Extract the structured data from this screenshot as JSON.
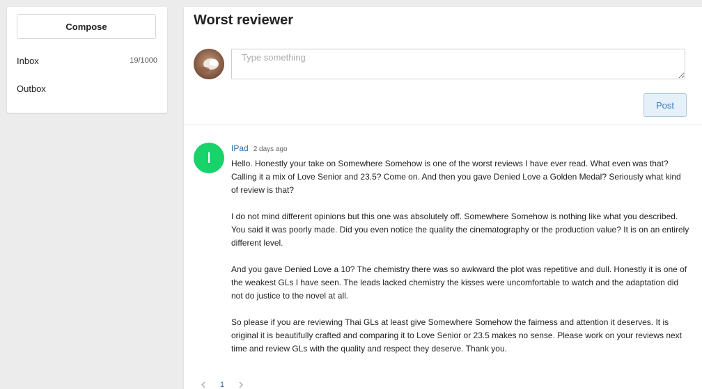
{
  "sidebar": {
    "compose_label": "Compose",
    "items": [
      {
        "label": "Inbox",
        "count": "19/1000"
      },
      {
        "label": "Outbox",
        "count": ""
      }
    ]
  },
  "thread": {
    "title": "Worst reviewer"
  },
  "composer": {
    "placeholder": "Type something",
    "post_label": "Post"
  },
  "comments": [
    {
      "avatar_letter": "I",
      "avatar_color": "#18d36a",
      "author": "IPad",
      "time": "2 days ago",
      "paragraphs": [
        "Hello. Honestly your take on Somewhere Somehow is one of the worst reviews I have ever read. What even was that? Calling it a mix of Love Senior and 23.5? Come on. And then you gave Denied Love a Golden Medal? Seriously what kind of review is that?",
        "I do not mind different opinions but this one was absolutely off. Somewhere Somehow is nothing like what you described. You said it was poorly made. Did you even notice the quality the cinematography or the production value? It is on an entirely different level.",
        "And you gave Denied Love a 10? The chemistry there was so awkward the plot was repetitive and dull. Honestly it is one of the weakest GLs I have seen. The leads lacked chemistry the kisses were uncomfortable to watch and the adaptation did not do justice to the novel at all.",
        "So please if you are reviewing Thai GLs at least give Somewhere Somehow the fairness and attention it deserves. It is original it is beautifully crafted and comparing it to Love Senior or 23.5 makes no sense. Please work on your reviews next time and review GLs with the quality and respect they deserve. Thank you."
      ]
    }
  ],
  "pagination": {
    "current_page": "1"
  },
  "colors": {
    "link": "#2a6cb0",
    "post_button_bg": "#e6f0f9",
    "background": "#ececec"
  }
}
